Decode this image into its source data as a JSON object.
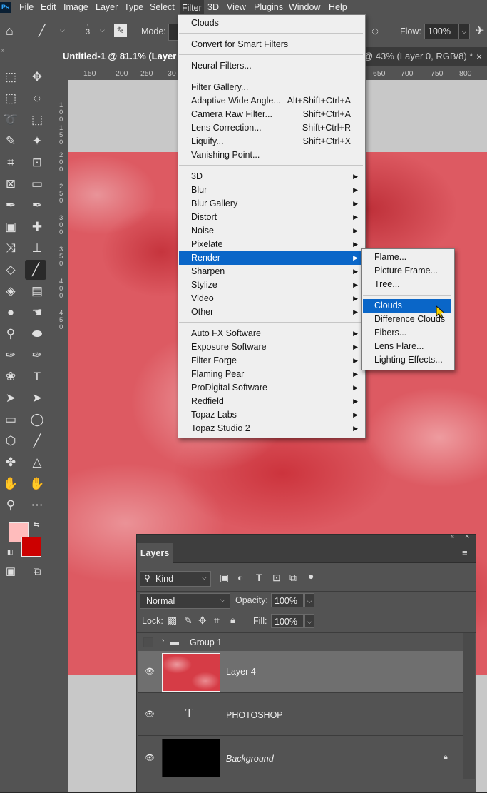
{
  "menubar": {
    "logo": "Ps",
    "items": [
      "File",
      "Edit",
      "Image",
      "Layer",
      "Type",
      "Select",
      "Filter",
      "3D",
      "View",
      "Plugins",
      "Window",
      "Help"
    ],
    "active": "Filter"
  },
  "options": {
    "brush_size": "3",
    "mode_label": "Mode:",
    "flow_label": "Flow:",
    "flow_value": "100%"
  },
  "tabs": {
    "doc1": "Untitled-1 @ 81.1% (Layer",
    "doc2": "@ 43% (Layer 0, RGB/8) *",
    "close": "×"
  },
  "ruler": {
    "h_ticks": [
      "150",
      "200",
      "250",
      "30",
      "650",
      "700",
      "750",
      "800"
    ],
    "v_ticks": [
      "1\n0\n0",
      "1\n5\n0",
      "2\n0\n0",
      "2\n5\n0",
      "3\n0\n0",
      "3\n5\n0",
      "4\n0\n0",
      "4\n5\n0"
    ]
  },
  "filter_menu": {
    "items": [
      {
        "label": "Clouds",
        "shortcut": "",
        "submenu": false
      },
      {
        "label": "Convert for Smart Filters",
        "shortcut": "",
        "submenu": false
      },
      {
        "label": "Neural Filters...",
        "shortcut": "",
        "submenu": false
      },
      {
        "label": "Filter Gallery...",
        "shortcut": "",
        "submenu": false
      },
      {
        "label": "Adaptive Wide Angle...",
        "shortcut": "Alt+Shift+Ctrl+A",
        "submenu": false
      },
      {
        "label": "Camera Raw Filter...",
        "shortcut": "Shift+Ctrl+A",
        "submenu": false
      },
      {
        "label": "Lens Correction...",
        "shortcut": "Shift+Ctrl+R",
        "submenu": false
      },
      {
        "label": "Liquify...",
        "shortcut": "Shift+Ctrl+X",
        "submenu": false
      },
      {
        "label": "Vanishing Point...",
        "shortcut": "",
        "submenu": false
      },
      {
        "label": "3D",
        "shortcut": "",
        "submenu": true
      },
      {
        "label": "Blur",
        "shortcut": "",
        "submenu": true
      },
      {
        "label": "Blur Gallery",
        "shortcut": "",
        "submenu": true
      },
      {
        "label": "Distort",
        "shortcut": "",
        "submenu": true
      },
      {
        "label": "Noise",
        "shortcut": "",
        "submenu": true
      },
      {
        "label": "Pixelate",
        "shortcut": "",
        "submenu": true
      },
      {
        "label": "Render",
        "shortcut": "",
        "submenu": true
      },
      {
        "label": "Sharpen",
        "shortcut": "",
        "submenu": true
      },
      {
        "label": "Stylize",
        "shortcut": "",
        "submenu": true
      },
      {
        "label": "Video",
        "shortcut": "",
        "submenu": true
      },
      {
        "label": "Other",
        "shortcut": "",
        "submenu": true
      },
      {
        "label": "Auto FX Software",
        "shortcut": "",
        "submenu": true
      },
      {
        "label": "Exposure Software",
        "shortcut": "",
        "submenu": true
      },
      {
        "label": "Filter Forge",
        "shortcut": "",
        "submenu": true
      },
      {
        "label": "Flaming Pear",
        "shortcut": "",
        "submenu": true
      },
      {
        "label": "ProDigital Software",
        "shortcut": "",
        "submenu": true
      },
      {
        "label": "Redfield",
        "shortcut": "",
        "submenu": true
      },
      {
        "label": "Topaz Labs",
        "shortcut": "",
        "submenu": true
      },
      {
        "label": "Topaz Studio 2",
        "shortcut": "",
        "submenu": true
      }
    ],
    "highlighted": "Render"
  },
  "render_submenu": {
    "items": [
      "Flame...",
      "Picture Frame...",
      "Tree...",
      "Clouds",
      "Difference Clouds",
      "Fibers...",
      "Lens Flare...",
      "Lighting Effects..."
    ],
    "highlighted": "Clouds"
  },
  "layers_panel": {
    "title": "Layers",
    "kind_label": "Kind",
    "blend_mode": "Normal",
    "opacity_label": "Opacity:",
    "opacity_value": "100%",
    "lock_label": "Lock:",
    "fill_label": "Fill:",
    "fill_value": "100%",
    "group_name": "Group 1",
    "layers": [
      {
        "name": "Layer 4",
        "selected": true
      },
      {
        "name": "PHOTOSHOP",
        "type_glyph": "T"
      },
      {
        "name": "Background",
        "locked": true
      }
    ]
  },
  "colors": {
    "foreground": "#ffbcbc",
    "background": "#cc0000",
    "menu_highlight": "#0a66c8"
  }
}
